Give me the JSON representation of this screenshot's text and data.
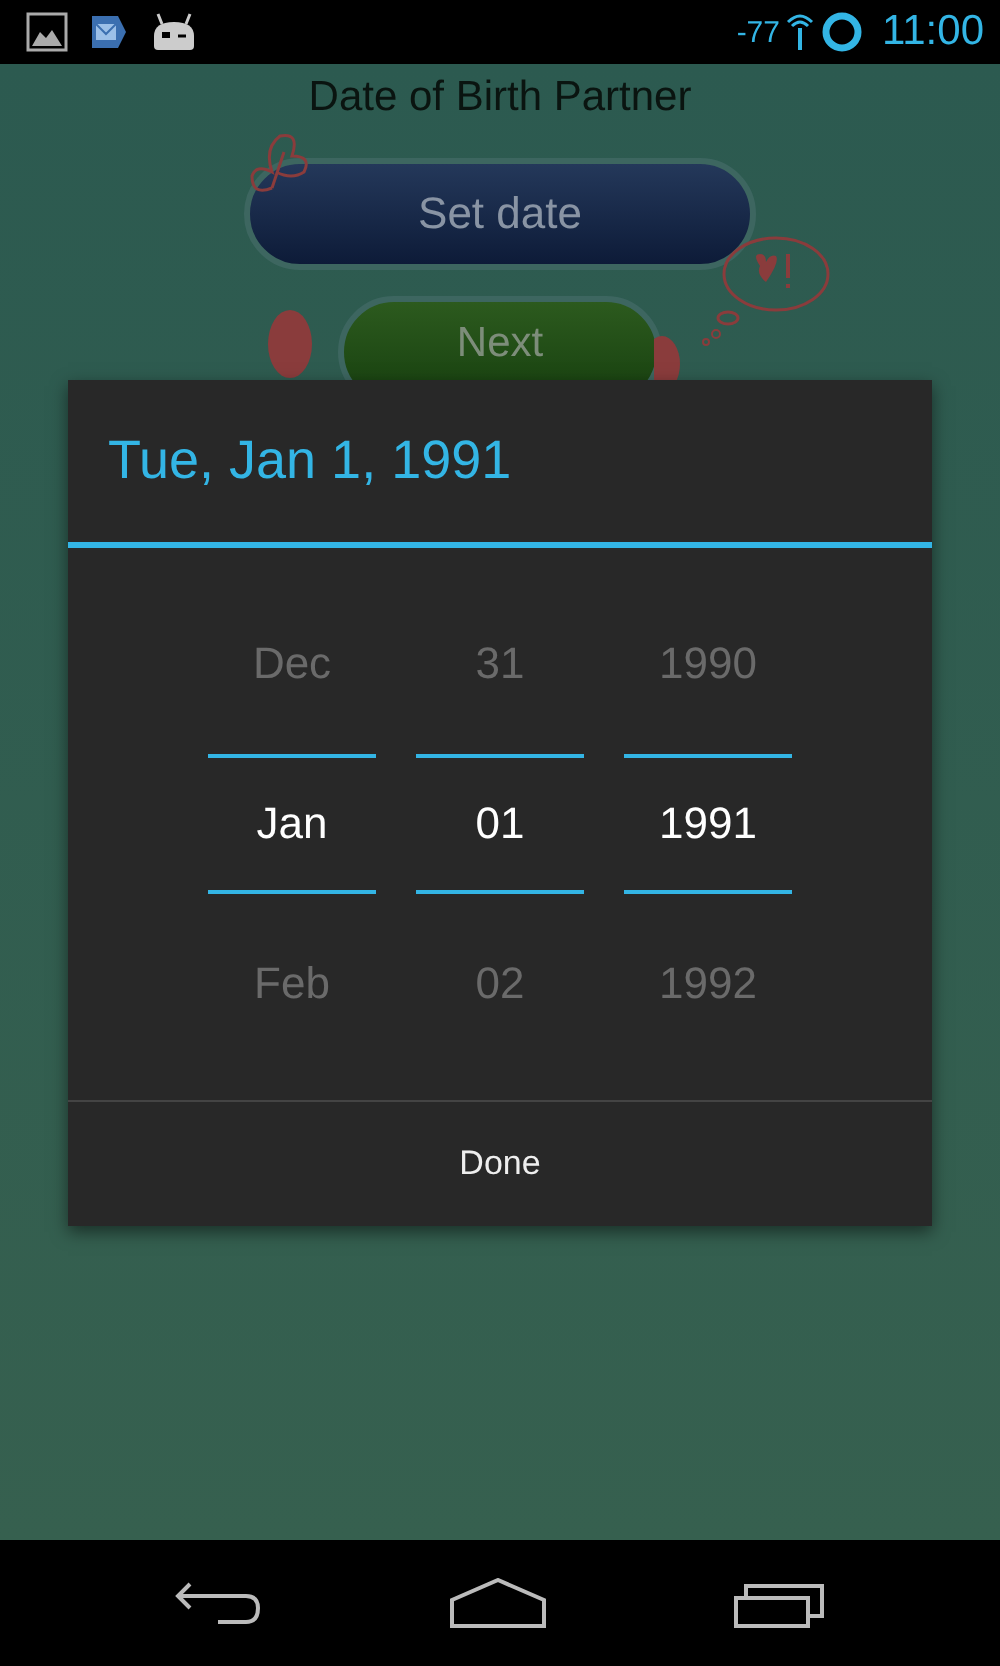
{
  "status_bar": {
    "signal_reading": "-77",
    "time": "11:00"
  },
  "page": {
    "title": "Date of Birth Partner",
    "buttons": [
      "Set date",
      "Next"
    ]
  },
  "dialog": {
    "title": "Tue, Jan 1, 1991",
    "columns": [
      {
        "values": [
          {
            "text": "Dec",
            "selected": false
          },
          {
            "text": "Jan",
            "selected": true
          },
          {
            "text": "Feb",
            "selected": false
          }
        ]
      },
      {
        "values": [
          {
            "text": "31",
            "selected": false
          },
          {
            "text": "01",
            "selected": true
          },
          {
            "text": "02",
            "selected": false
          }
        ]
      },
      {
        "values": [
          {
            "text": "1990",
            "selected": false
          },
          {
            "text": "1991",
            "selected": true
          },
          {
            "text": "1992",
            "selected": false
          }
        ]
      }
    ],
    "button": "Done"
  }
}
